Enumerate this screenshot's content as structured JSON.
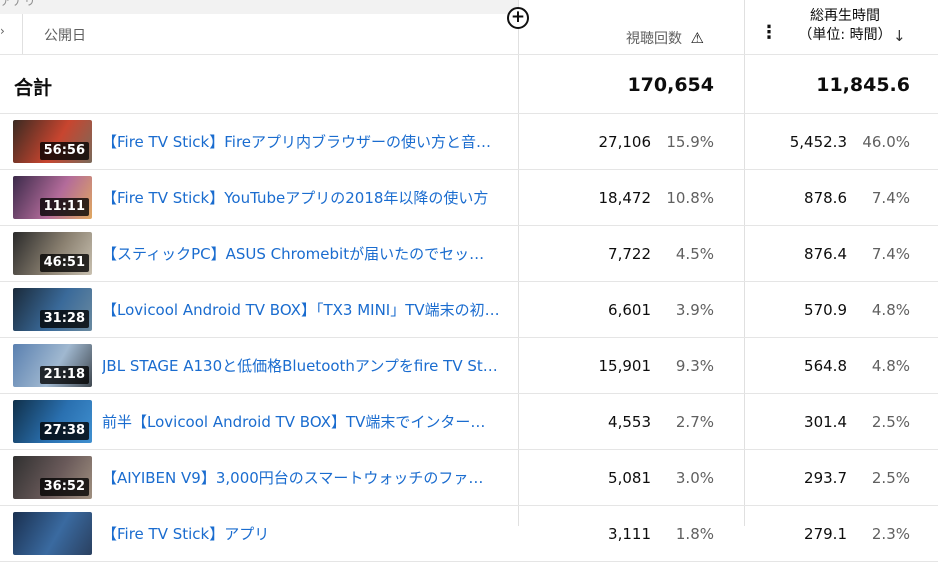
{
  "header": {
    "top_cut_label": "アナリ",
    "col_published": "公開日",
    "col_views": "視聴回数",
    "col_watch_line1": "総再生時間",
    "col_watch_line2": "（単位: 時間）",
    "sort_arrow": "↓",
    "warning_glyph": "⚠",
    "menu_glyph": "⋮",
    "add_glyph": "+"
  },
  "totals": {
    "label": "合計",
    "views": "170,654",
    "watch": "11,845.6"
  },
  "rows": [
    {
      "title": "【Fire TV Stick】Fireアプリ内ブラウザーの使い方と音…",
      "duration": "56:56",
      "views": "27,106",
      "views_pct": "15.9%",
      "watch": "5,452.3",
      "watch_pct": "46.0%",
      "thumb_colors": [
        "#3a2a22",
        "#c8452f",
        "#7a6a5a"
      ]
    },
    {
      "title": "【Fire TV Stick】YouTubeアプリの2018年以降の使い方",
      "duration": "11:11",
      "views": "18,472",
      "views_pct": "10.8%",
      "watch": "878.6",
      "watch_pct": "7.4%",
      "thumb_colors": [
        "#3b2a4a",
        "#b36b9a",
        "#e0a860"
      ]
    },
    {
      "title": "【スティックPC】ASUS Chromebitが届いたのでセッ…",
      "duration": "46:51",
      "views": "7,722",
      "views_pct": "4.5%",
      "watch": "876.4",
      "watch_pct": "7.4%",
      "thumb_colors": [
        "#2a2a2a",
        "#8a8070",
        "#c8c0b0"
      ]
    },
    {
      "title": "【Lovicool Android TV BOX】「TX3 MINI」TV端末の初…",
      "duration": "31:28",
      "views": "6,601",
      "views_pct": "3.9%",
      "watch": "570.9",
      "watch_pct": "4.8%",
      "thumb_colors": [
        "#1a2a3a",
        "#3a6a9a",
        "#6a8aa0"
      ]
    },
    {
      "title": "JBL STAGE A130と低価格Bluetoothアンプをfire TV St…",
      "duration": "21:18",
      "views": "15,901",
      "views_pct": "9.3%",
      "watch": "564.8",
      "watch_pct": "4.8%",
      "thumb_colors": [
        "#5a80b0",
        "#a0b8d0",
        "#404850"
      ]
    },
    {
      "title": "前半【Lovicool Android TV BOX】TV端末でインター…",
      "duration": "27:38",
      "views": "4,553",
      "views_pct": "2.7%",
      "watch": "301.4",
      "watch_pct": "2.5%",
      "thumb_colors": [
        "#10304a",
        "#2a70b0",
        "#4090d0"
      ]
    },
    {
      "title": "【AIYIBEN V9】3,000円台のスマートウォッチのファ…",
      "duration": "36:52",
      "views": "5,081",
      "views_pct": "3.0%",
      "watch": "293.7",
      "watch_pct": "2.5%",
      "thumb_colors": [
        "#303030",
        "#6a5a5a",
        "#a09080"
      ]
    },
    {
      "title": "【Fire TV Stick】アプリ",
      "duration": "",
      "views": "3,111",
      "views_pct": "1.8%",
      "watch": "279.1",
      "watch_pct": "2.3%",
      "thumb_colors": [
        "#1a3050",
        "#3a6aa0",
        "#2a4060"
      ]
    }
  ]
}
